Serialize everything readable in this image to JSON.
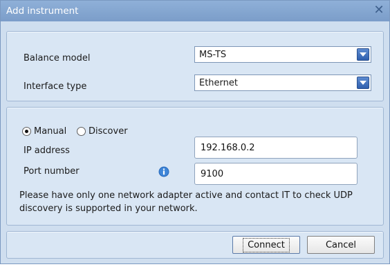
{
  "window": {
    "title": "Add instrument",
    "close_icon": "close-icon"
  },
  "model_panel": {
    "balance_model_label": "Balance model",
    "balance_model_value": "MS-TS",
    "interface_type_label": "Interface type",
    "interface_type_value": "Ethernet",
    "dropdown_icon": "chevron-down-icon"
  },
  "connection_panel": {
    "manual_label": "Manual",
    "discover_label": "Discover",
    "selected_mode": "Manual",
    "ip_address_label": "IP address",
    "ip_address_value": "192.168.0.2",
    "port_number_label": "Port number",
    "port_number_value": "9100",
    "info_icon": "info-icon",
    "note": "Please have only one network adapter active and contact IT to check UDP discovery is supported in your network."
  },
  "buttons": {
    "connect_label": "Connect",
    "cancel_label": "Cancel"
  },
  "colors": {
    "title_bar": "#7b9dc9",
    "dialog_background": "#cfdeef",
    "dropdown_button": "#2f5fae",
    "info_icon": "#2e6fc0"
  }
}
